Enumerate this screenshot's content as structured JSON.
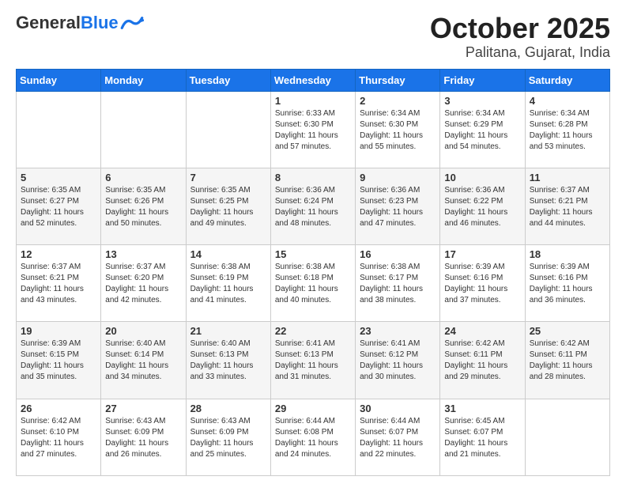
{
  "header": {
    "logo_general": "General",
    "logo_blue": "Blue",
    "title": "October 2025",
    "subtitle": "Palitana, Gujarat, India"
  },
  "days_of_week": [
    "Sunday",
    "Monday",
    "Tuesday",
    "Wednesday",
    "Thursday",
    "Friday",
    "Saturday"
  ],
  "weeks": [
    [
      {
        "day": "",
        "info": ""
      },
      {
        "day": "",
        "info": ""
      },
      {
        "day": "",
        "info": ""
      },
      {
        "day": "1",
        "info": "Sunrise: 6:33 AM\nSunset: 6:30 PM\nDaylight: 11 hours and 57 minutes."
      },
      {
        "day": "2",
        "info": "Sunrise: 6:34 AM\nSunset: 6:30 PM\nDaylight: 11 hours and 55 minutes."
      },
      {
        "day": "3",
        "info": "Sunrise: 6:34 AM\nSunset: 6:29 PM\nDaylight: 11 hours and 54 minutes."
      },
      {
        "day": "4",
        "info": "Sunrise: 6:34 AM\nSunset: 6:28 PM\nDaylight: 11 hours and 53 minutes."
      }
    ],
    [
      {
        "day": "5",
        "info": "Sunrise: 6:35 AM\nSunset: 6:27 PM\nDaylight: 11 hours and 52 minutes."
      },
      {
        "day": "6",
        "info": "Sunrise: 6:35 AM\nSunset: 6:26 PM\nDaylight: 11 hours and 50 minutes."
      },
      {
        "day": "7",
        "info": "Sunrise: 6:35 AM\nSunset: 6:25 PM\nDaylight: 11 hours and 49 minutes."
      },
      {
        "day": "8",
        "info": "Sunrise: 6:36 AM\nSunset: 6:24 PM\nDaylight: 11 hours and 48 minutes."
      },
      {
        "day": "9",
        "info": "Sunrise: 6:36 AM\nSunset: 6:23 PM\nDaylight: 11 hours and 47 minutes."
      },
      {
        "day": "10",
        "info": "Sunrise: 6:36 AM\nSunset: 6:22 PM\nDaylight: 11 hours and 46 minutes."
      },
      {
        "day": "11",
        "info": "Sunrise: 6:37 AM\nSunset: 6:21 PM\nDaylight: 11 hours and 44 minutes."
      }
    ],
    [
      {
        "day": "12",
        "info": "Sunrise: 6:37 AM\nSunset: 6:21 PM\nDaylight: 11 hours and 43 minutes."
      },
      {
        "day": "13",
        "info": "Sunrise: 6:37 AM\nSunset: 6:20 PM\nDaylight: 11 hours and 42 minutes."
      },
      {
        "day": "14",
        "info": "Sunrise: 6:38 AM\nSunset: 6:19 PM\nDaylight: 11 hours and 41 minutes."
      },
      {
        "day": "15",
        "info": "Sunrise: 6:38 AM\nSunset: 6:18 PM\nDaylight: 11 hours and 40 minutes."
      },
      {
        "day": "16",
        "info": "Sunrise: 6:38 AM\nSunset: 6:17 PM\nDaylight: 11 hours and 38 minutes."
      },
      {
        "day": "17",
        "info": "Sunrise: 6:39 AM\nSunset: 6:16 PM\nDaylight: 11 hours and 37 minutes."
      },
      {
        "day": "18",
        "info": "Sunrise: 6:39 AM\nSunset: 6:16 PM\nDaylight: 11 hours and 36 minutes."
      }
    ],
    [
      {
        "day": "19",
        "info": "Sunrise: 6:39 AM\nSunset: 6:15 PM\nDaylight: 11 hours and 35 minutes."
      },
      {
        "day": "20",
        "info": "Sunrise: 6:40 AM\nSunset: 6:14 PM\nDaylight: 11 hours and 34 minutes."
      },
      {
        "day": "21",
        "info": "Sunrise: 6:40 AM\nSunset: 6:13 PM\nDaylight: 11 hours and 33 minutes."
      },
      {
        "day": "22",
        "info": "Sunrise: 6:41 AM\nSunset: 6:13 PM\nDaylight: 11 hours and 31 minutes."
      },
      {
        "day": "23",
        "info": "Sunrise: 6:41 AM\nSunset: 6:12 PM\nDaylight: 11 hours and 30 minutes."
      },
      {
        "day": "24",
        "info": "Sunrise: 6:42 AM\nSunset: 6:11 PM\nDaylight: 11 hours and 29 minutes."
      },
      {
        "day": "25",
        "info": "Sunrise: 6:42 AM\nSunset: 6:11 PM\nDaylight: 11 hours and 28 minutes."
      }
    ],
    [
      {
        "day": "26",
        "info": "Sunrise: 6:42 AM\nSunset: 6:10 PM\nDaylight: 11 hours and 27 minutes."
      },
      {
        "day": "27",
        "info": "Sunrise: 6:43 AM\nSunset: 6:09 PM\nDaylight: 11 hours and 26 minutes."
      },
      {
        "day": "28",
        "info": "Sunrise: 6:43 AM\nSunset: 6:09 PM\nDaylight: 11 hours and 25 minutes."
      },
      {
        "day": "29",
        "info": "Sunrise: 6:44 AM\nSunset: 6:08 PM\nDaylight: 11 hours and 24 minutes."
      },
      {
        "day": "30",
        "info": "Sunrise: 6:44 AM\nSunset: 6:07 PM\nDaylight: 11 hours and 22 minutes."
      },
      {
        "day": "31",
        "info": "Sunrise: 6:45 AM\nSunset: 6:07 PM\nDaylight: 11 hours and 21 minutes."
      },
      {
        "day": "",
        "info": ""
      }
    ]
  ]
}
